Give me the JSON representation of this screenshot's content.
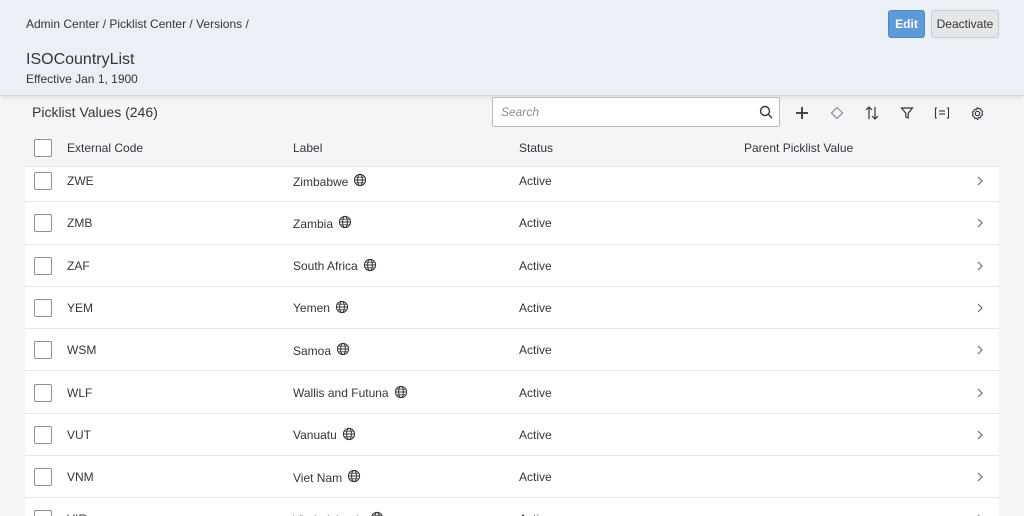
{
  "breadcrumb": [
    "Admin Center",
    "Picklist Center",
    "Versions"
  ],
  "header": {
    "title": "ISOCountryList",
    "subtitle": "Effective Jan 1, 1900",
    "edit_label": "Edit",
    "deactivate_label": "Deactivate"
  },
  "toolbar": {
    "title": "Picklist Values (246)",
    "search_placeholder": "Search",
    "search_value": "",
    "icons": [
      "add-icon",
      "diamond-icon",
      "sort-icon",
      "filter-icon",
      "group-icon",
      "settings-icon"
    ]
  },
  "table": {
    "columns": [
      "External Code",
      "Label",
      "Status",
      "Parent Picklist Value"
    ],
    "rows": [
      {
        "code": "ZWE",
        "label": "Zimbabwe",
        "status": "Active",
        "parent": ""
      },
      {
        "code": "ZMB",
        "label": "Zambia",
        "status": "Active",
        "parent": ""
      },
      {
        "code": "ZAF",
        "label": "South Africa",
        "status": "Active",
        "parent": ""
      },
      {
        "code": "YEM",
        "label": "Yemen",
        "status": "Active",
        "parent": ""
      },
      {
        "code": "WSM",
        "label": "Samoa",
        "status": "Active",
        "parent": ""
      },
      {
        "code": "WLF",
        "label": "Wallis and Futuna",
        "status": "Active",
        "parent": ""
      },
      {
        "code": "VUT",
        "label": "Vanuatu",
        "status": "Active",
        "parent": ""
      },
      {
        "code": "VNM",
        "label": "Viet Nam",
        "status": "Active",
        "parent": ""
      },
      {
        "code": "VIR",
        "label": "Virgin Islands",
        "status": "Active",
        "parent": ""
      }
    ]
  },
  "colors": {
    "header_bg": "#eaf0f6",
    "edit_button": "#5d9bd8",
    "page_bg": "#f4f5f6"
  }
}
